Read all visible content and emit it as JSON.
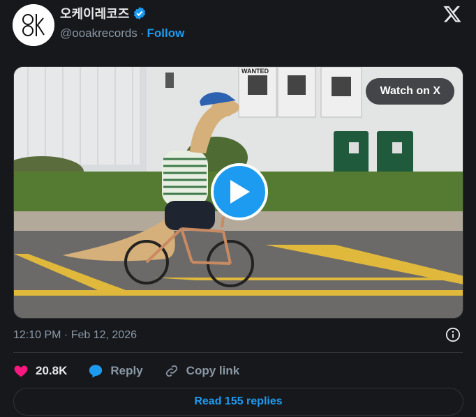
{
  "author": {
    "display_name": "오케이레코즈",
    "handle": "@ooakrecords",
    "separator": "·",
    "follow_label": "Follow",
    "avatar_text": "oak"
  },
  "media": {
    "watch_label": "Watch on X",
    "poster_text": "WANTED"
  },
  "meta": {
    "timestamp": "12:10 PM · Feb 12, 2026"
  },
  "actions": {
    "likes": "20.8K",
    "reply_label": "Reply",
    "copy_label": "Copy link"
  },
  "footer": {
    "read_replies": "Read 155 replies"
  },
  "colors": {
    "accent": "#1d9bf0",
    "like": "#f91880",
    "background": "#16181c"
  }
}
